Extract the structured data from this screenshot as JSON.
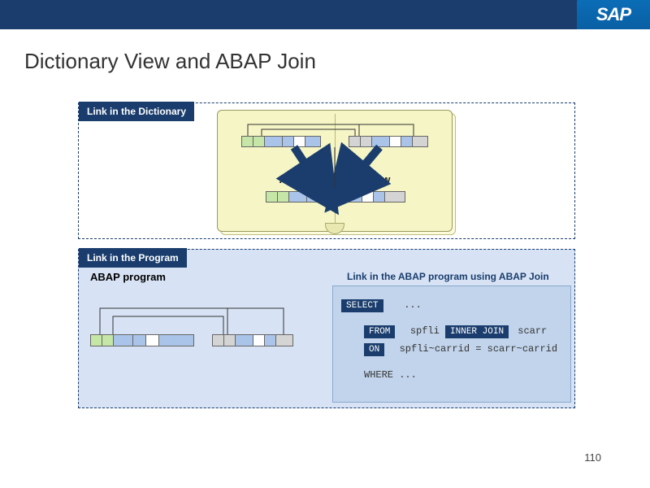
{
  "logo": "SAP",
  "title": "Dictionary View and ABAP Join",
  "panel1": {
    "tab": "Link in the Dictionary",
    "label": "ABAP Dictionary View"
  },
  "panel2": {
    "tab": "Link in the Program",
    "heading1": "ABAP program",
    "heading2": "Link in the ABAP program using ABAP Join"
  },
  "code": {
    "select": "SELECT",
    "dots": "...",
    "from": "FROM",
    "t1": "spfli",
    "join": "INNER JOIN",
    "t2": "scarr",
    "on": "ON",
    "cond": "spfli~carrid = scarr~carrid",
    "where": "WHERE ..."
  },
  "pagenum": "110",
  "colors": {
    "navy": "#1a3d6d",
    "lightblue": "#d7e3f4",
    "book": "#f5f5c5"
  }
}
